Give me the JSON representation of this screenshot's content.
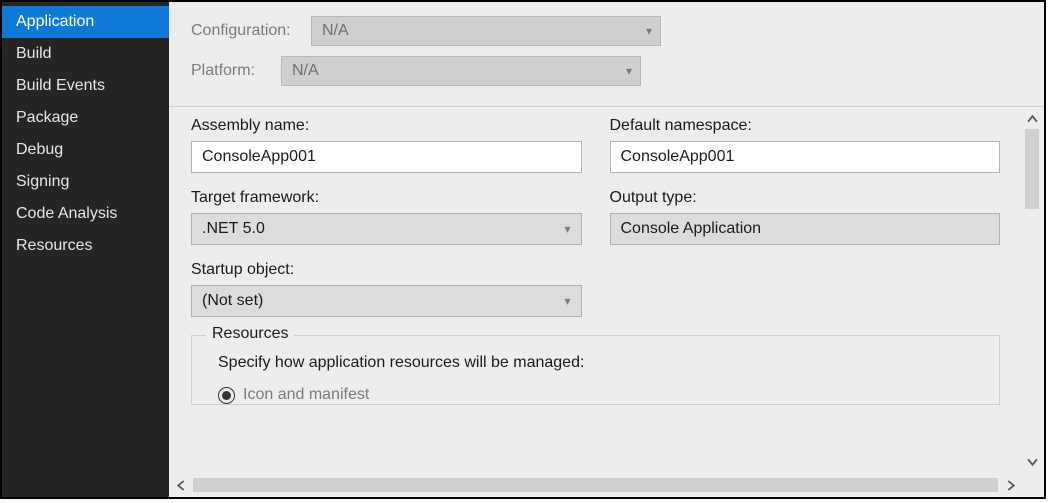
{
  "sidebar": {
    "items": [
      {
        "label": "Application",
        "active": true
      },
      {
        "label": "Build"
      },
      {
        "label": "Build Events"
      },
      {
        "label": "Package"
      },
      {
        "label": "Debug"
      },
      {
        "label": "Signing"
      },
      {
        "label": "Code Analysis"
      },
      {
        "label": "Resources"
      }
    ]
  },
  "topbar": {
    "configuration_label": "Configuration:",
    "configuration_value": "N/A",
    "platform_label": "Platform:",
    "platform_value": "N/A"
  },
  "form": {
    "assembly_name_label": "Assembly name:",
    "assembly_name_value": "ConsoleApp001",
    "default_namespace_label": "Default namespace:",
    "default_namespace_value": "ConsoleApp001",
    "target_framework_label": "Target framework:",
    "target_framework_value": ".NET 5.0",
    "output_type_label": "Output type:",
    "output_type_value": "Console Application",
    "startup_object_label": "Startup object:",
    "startup_object_value": "(Not set)"
  },
  "resources": {
    "legend": "Resources",
    "description": "Specify how application resources will be managed:",
    "option_icon_manifest": "Icon and manifest"
  }
}
